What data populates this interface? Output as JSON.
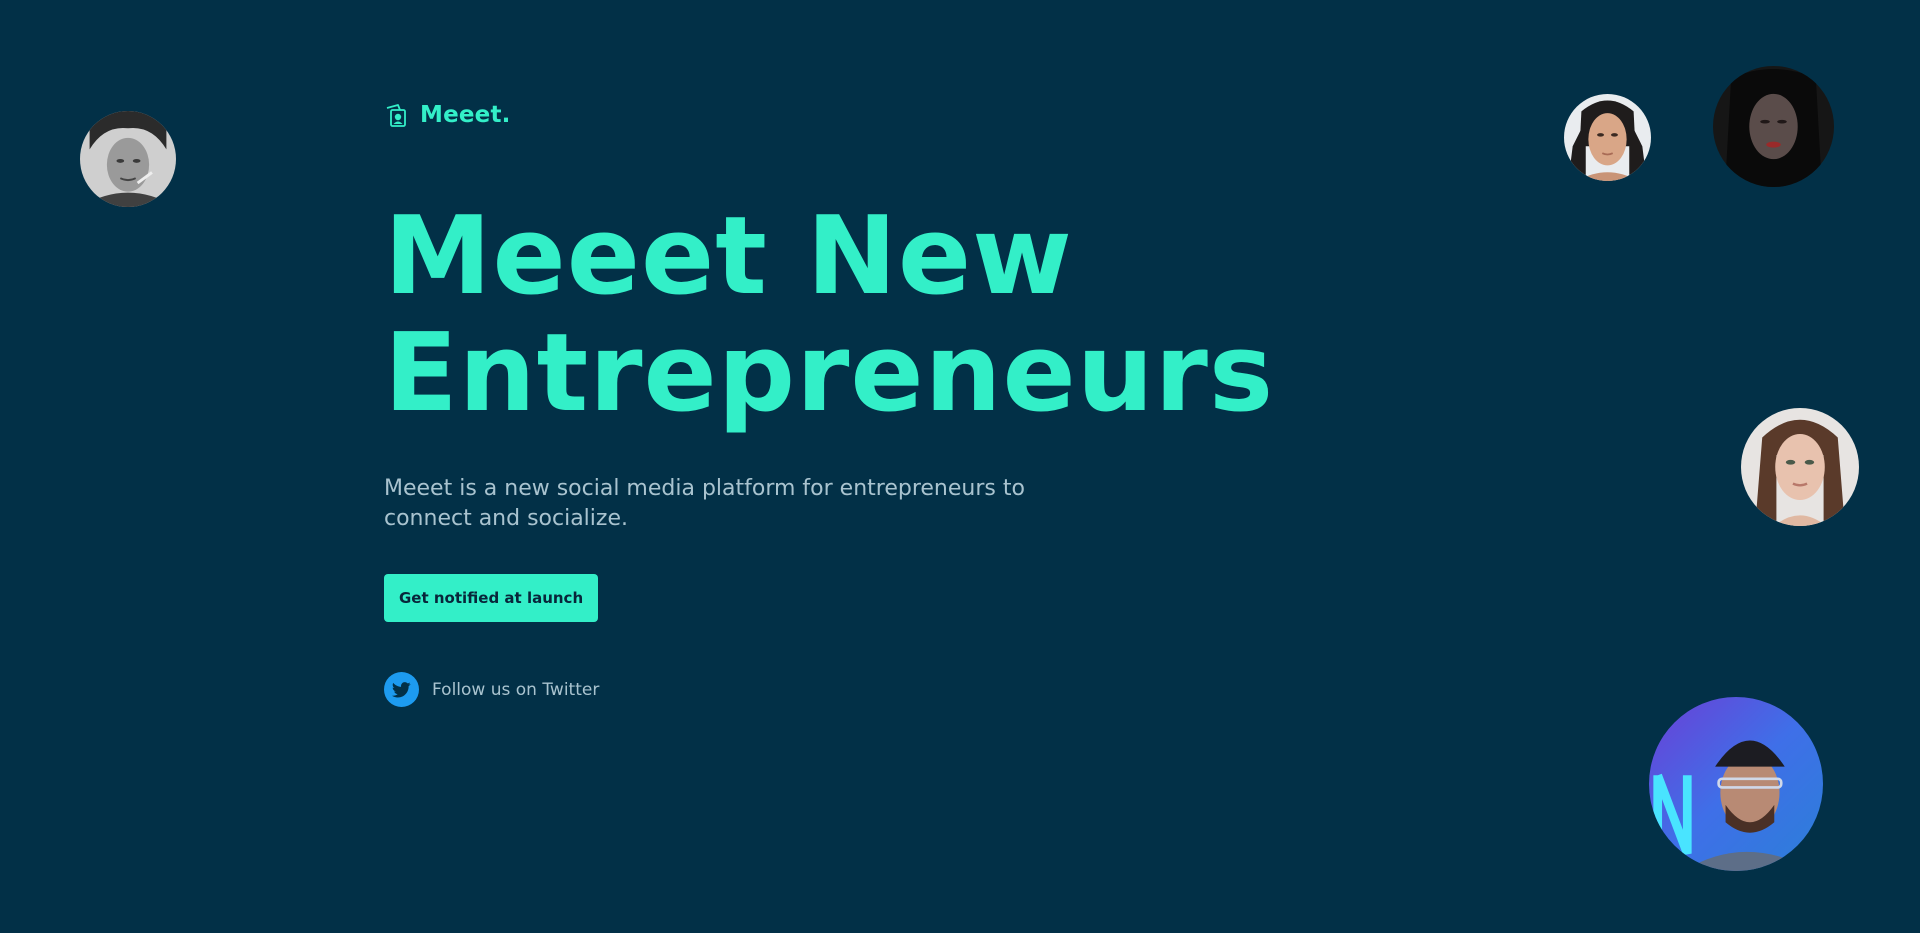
{
  "brand": {
    "name": "Meeet.",
    "icon": "photo-stack-icon"
  },
  "hero": {
    "title_line1": "Meeet New",
    "title_line2": "Entrepreneurs",
    "description": "Meeet is a new social media platform for entrepreneurs to connect and socialize."
  },
  "cta": {
    "label": "Get notified at launch"
  },
  "social": {
    "label": "Follow us on Twitter",
    "icon": "twitter-icon"
  },
  "colors": {
    "background": "#023047",
    "accent": "#33efc8",
    "text_muted": "#a9c3cf",
    "twitter": "#1d9bf0"
  }
}
